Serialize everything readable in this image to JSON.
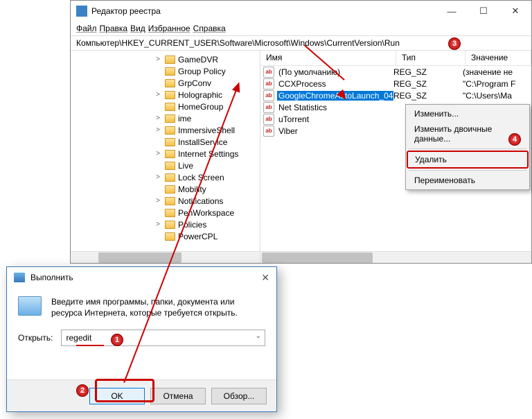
{
  "regedit": {
    "title": "Редактор реестра",
    "menu": [
      "Файл",
      "Правка",
      "Вид",
      "Избранное",
      "Справка"
    ],
    "address": "Компьютер\\HKEY_CURRENT_USER\\Software\\Microsoft\\Windows\\CurrentVersion\\Run",
    "tree": [
      "GameDVR",
      "Group Policy",
      "GrpConv",
      "Holographic",
      "HomeGroup",
      "ime",
      "ImmersiveShell",
      "InstallService",
      "Internet Settings",
      "Live",
      "Lock Screen",
      "Mobility",
      "Notifications",
      "PenWorkspace",
      "Policies",
      "PowerCPL"
    ],
    "tree_expandable": [
      true,
      false,
      false,
      true,
      false,
      true,
      true,
      false,
      true,
      false,
      true,
      false,
      true,
      false,
      true,
      false
    ],
    "columns": {
      "name": "Имя",
      "type": "Тип",
      "data": "Значение"
    },
    "values": [
      {
        "name": "(По умолчанию)",
        "type": "REG_SZ",
        "data": "(значение не"
      },
      {
        "name": "CCXProcess",
        "type": "REG_SZ",
        "data": "\"C:\\Program F"
      },
      {
        "name": "GoogleChromeAutoLaunch_04...",
        "type": "REG_SZ",
        "data": "\"C:\\Users\\Ma",
        "selected": true
      },
      {
        "name": "Net Statistics",
        "type": "",
        "data": ""
      },
      {
        "name": "uTorrent",
        "type": "",
        "data": ""
      },
      {
        "name": "Viber",
        "type": "",
        "data": ""
      }
    ]
  },
  "context_menu": {
    "items": [
      "Изменить...",
      "Изменить двоичные данные...",
      "Удалить",
      "Переименовать"
    ],
    "highlighted": 2
  },
  "run": {
    "title": "Выполнить",
    "description": "Введите имя программы, папки, документа или ресурса Интернета, которые требуется открыть.",
    "open_label": "Открыть:",
    "command": "regedit",
    "buttons": {
      "ok": "OK",
      "cancel": "Отмена",
      "browse": "Обзор..."
    }
  },
  "callouts": {
    "c1": "1",
    "c2": "2",
    "c3": "3",
    "c4": "4"
  }
}
